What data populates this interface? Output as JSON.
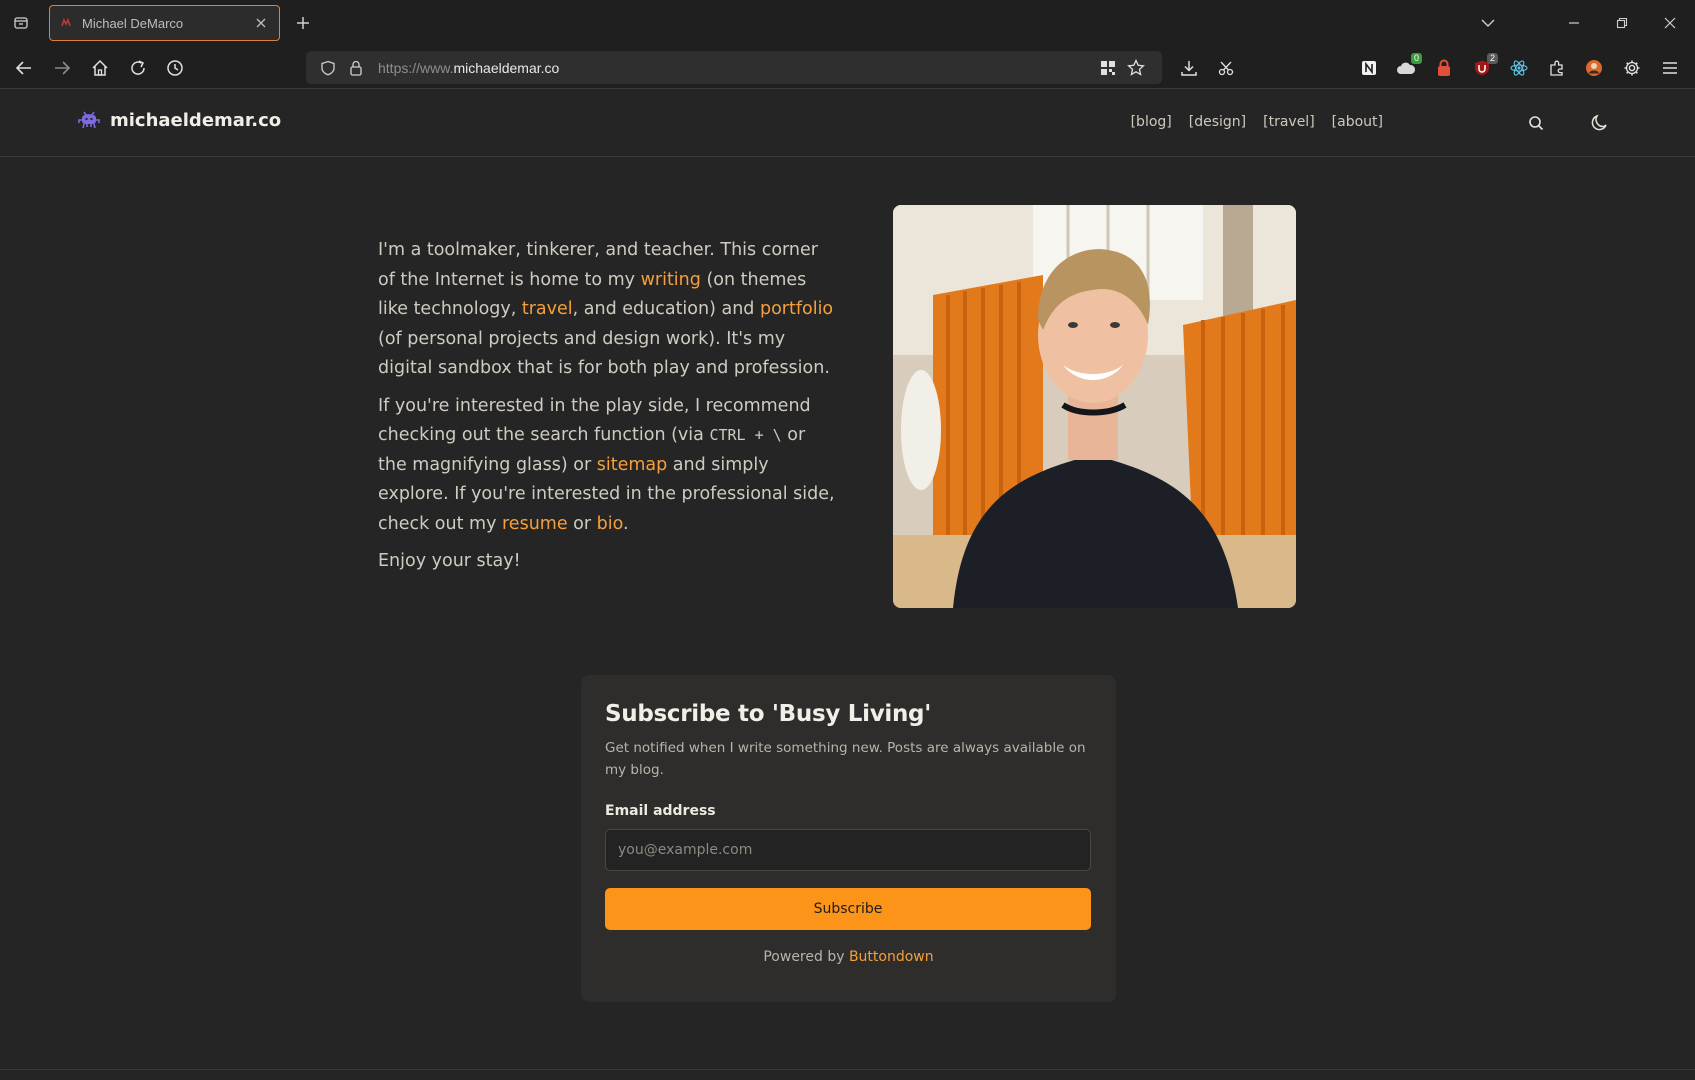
{
  "browser": {
    "tab_title": "Michael DeMarco",
    "url_prefix": "https://www.",
    "url_domain": "michaeldemar.co",
    "ext_badge_1": "0",
    "ext_badge_2": "2"
  },
  "site": {
    "logo_text": "michaeldemar.co",
    "nav": [
      "[blog]",
      "[design]",
      "[travel]",
      "[about]"
    ]
  },
  "intro": {
    "p1": {
      "t1": "I'm a toolmaker, tinkerer, and teacher. This corner of the Internet is home to my ",
      "link_writing": "writing",
      "t2": " (on themes like technology, ",
      "link_travel": "travel",
      "t3": ", and education) and ",
      "link_portfolio": "portfolio",
      "t4": " (of personal projects and design work). It's my digital sandbox that is for both play and profession."
    },
    "p2": {
      "t1": "If you're interested in the play side, I recommend checking out the search function (via ",
      "kbd": "CTRL + \\",
      "t2": " or the magnifying glass) or ",
      "link_sitemap": "sitemap",
      "t3": " and simply explore. If you're interested in the professional side, check out my ",
      "link_resume": "resume",
      "t4": " or ",
      "link_bio": "bio",
      "t5": "."
    },
    "p3": "Enjoy your stay!"
  },
  "subscribe": {
    "title": "Subscribe to 'Busy Living'",
    "description": "Get notified when I write something new. Posts are always available on my blog.",
    "email_label": "Email address",
    "email_placeholder": "you@example.com",
    "email_value": "",
    "button_label": "Subscribe",
    "powered_prefix": "Powered by ",
    "powered_link": "Buttondown"
  },
  "colors": {
    "accent": "#f5a03a",
    "button": "#fb9418",
    "background": "#252525",
    "tab_border": "#e0803a"
  }
}
